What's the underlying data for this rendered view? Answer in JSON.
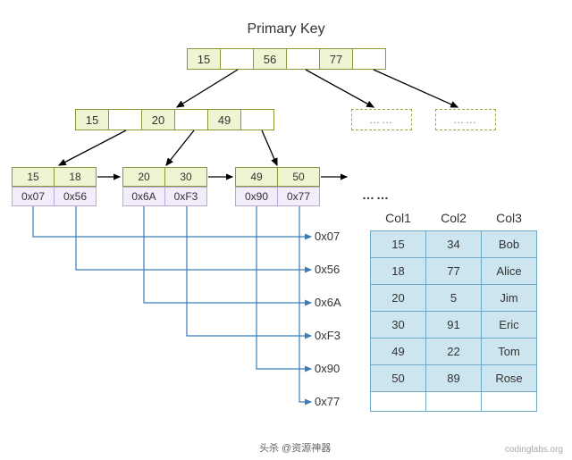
{
  "title": "Primary Key",
  "root": {
    "keys": [
      "15",
      "56",
      "77"
    ]
  },
  "mid": {
    "keys": [
      "15",
      "20",
      "49"
    ]
  },
  "dashed_label": "……",
  "leaves": [
    {
      "keys": [
        "15",
        "18"
      ],
      "ptrs": [
        "0x07",
        "0x56"
      ]
    },
    {
      "keys": [
        "20",
        "30"
      ],
      "ptrs": [
        "0x6A",
        "0xF3"
      ]
    },
    {
      "keys": [
        "49",
        "50"
      ],
      "ptrs": [
        "0x90",
        "0x77"
      ]
    }
  ],
  "leaf_ellipsis": "……",
  "ptr_labels": [
    "0x07",
    "0x56",
    "0x6A",
    "0xF3",
    "0x90",
    "0x77"
  ],
  "table": {
    "headers": [
      "Col1",
      "Col2",
      "Col3"
    ],
    "rows": [
      [
        "15",
        "34",
        "Bob"
      ],
      [
        "18",
        "77",
        "Alice"
      ],
      [
        "20",
        "5",
        "Jim"
      ],
      [
        "30",
        "91",
        "Eric"
      ],
      [
        "49",
        "22",
        "Tom"
      ],
      [
        "50",
        "89",
        "Rose"
      ]
    ]
  },
  "watermark_left": "头杀 @资源神器",
  "watermark_right": "codinglabs.org"
}
